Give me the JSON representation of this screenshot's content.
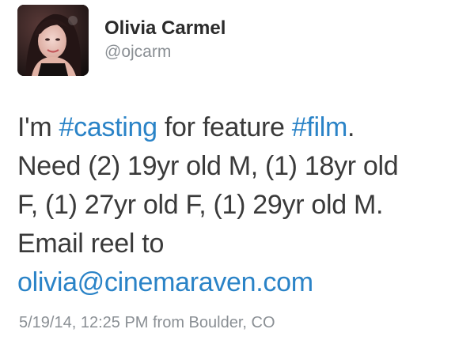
{
  "user": {
    "display_name": "Olivia Carmel",
    "handle": "@ojcarm",
    "avatar_alt": "profile-photo"
  },
  "tweet": {
    "line1": {
      "pre": "I'm ",
      "hashtag_casting": "#casting",
      "mid": " for feature ",
      "hashtag_film": "#film",
      "post": "."
    },
    "line2": "Need (2) 19yr old M, (1) 18yr old",
    "line3": "F, (1) 27yr old F, (1) 29yr old M.",
    "line4": "Email reel to",
    "email": "olivia@cinemaraven.com"
  },
  "meta": {
    "timestamp_source": "5/19/14, 12:25 PM from Boulder, CO"
  },
  "colors": {
    "link": "#2a83c7",
    "text": "#3a3a3a",
    "secondary": "#8a8f94"
  }
}
